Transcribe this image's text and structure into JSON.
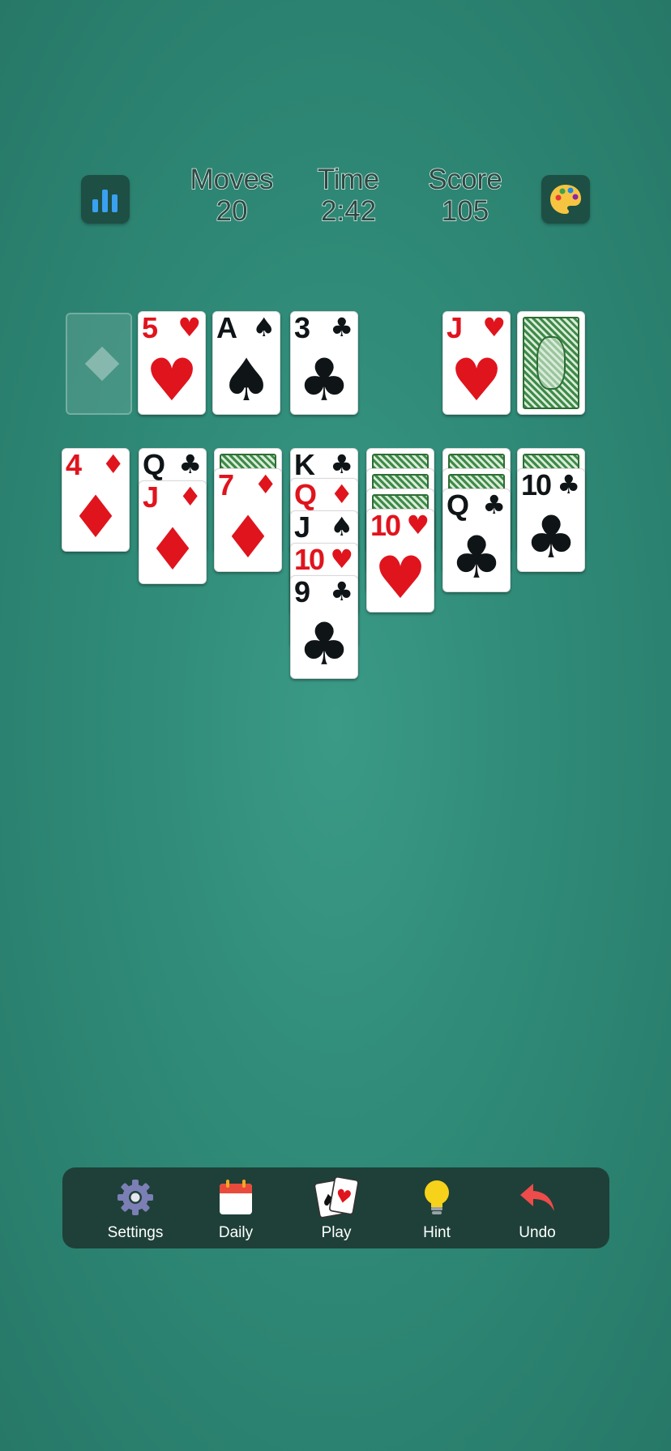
{
  "header": {
    "moves_label": "Moves",
    "moves_value": "20",
    "time_label": "Time",
    "time_value": "2:42",
    "score_label": "Score",
    "score_value": "105",
    "stats_icon": "bar-chart-icon",
    "theme_icon": "palette-icon"
  },
  "foundations": [
    {
      "rank": "5",
      "suit": "♥",
      "color": "red"
    },
    {
      "rank": "A",
      "suit": "♠",
      "color": "black"
    },
    {
      "rank": "3",
      "suit": "♣",
      "color": "black"
    }
  ],
  "waste": {
    "rank": "J",
    "suit": "♥",
    "color": "red"
  },
  "tableau": {
    "col1": [
      {
        "rank": "4",
        "suit": "♦",
        "color": "red"
      }
    ],
    "col2": [
      {
        "rank": "Q",
        "suit": "♣",
        "color": "black"
      },
      {
        "rank": "J",
        "suit": "♦",
        "color": "red"
      }
    ],
    "col3": [
      {
        "rank": "7",
        "suit": "♦",
        "color": "red"
      }
    ],
    "col4": [
      {
        "rank": "K",
        "suit": "♣",
        "color": "black"
      },
      {
        "rank": "Q",
        "suit": "♦",
        "color": "red"
      },
      {
        "rank": "J",
        "suit": "♠",
        "color": "black"
      },
      {
        "rank": "10",
        "suit": "♥",
        "color": "red"
      },
      {
        "rank": "9",
        "suit": "♣",
        "color": "black"
      }
    ],
    "col5": [
      {
        "rank": "10",
        "suit": "♥",
        "color": "red"
      }
    ],
    "col6": [
      {
        "rank": "Q",
        "suit": "♣",
        "color": "black"
      }
    ],
    "col7": [
      {
        "rank": "10",
        "suit": "♣",
        "color": "black"
      }
    ]
  },
  "toolbar": {
    "settings_label": "Settings",
    "daily_label": "Daily",
    "play_label": "Play",
    "hint_label": "Hint",
    "undo_label": "Undo"
  },
  "colors": {
    "table_green": "#2f8a77",
    "toolbar_bg": "#1e4038",
    "card_red": "#e0141d",
    "card_black": "#0f1417",
    "card_back_green": "#3e8a47"
  }
}
